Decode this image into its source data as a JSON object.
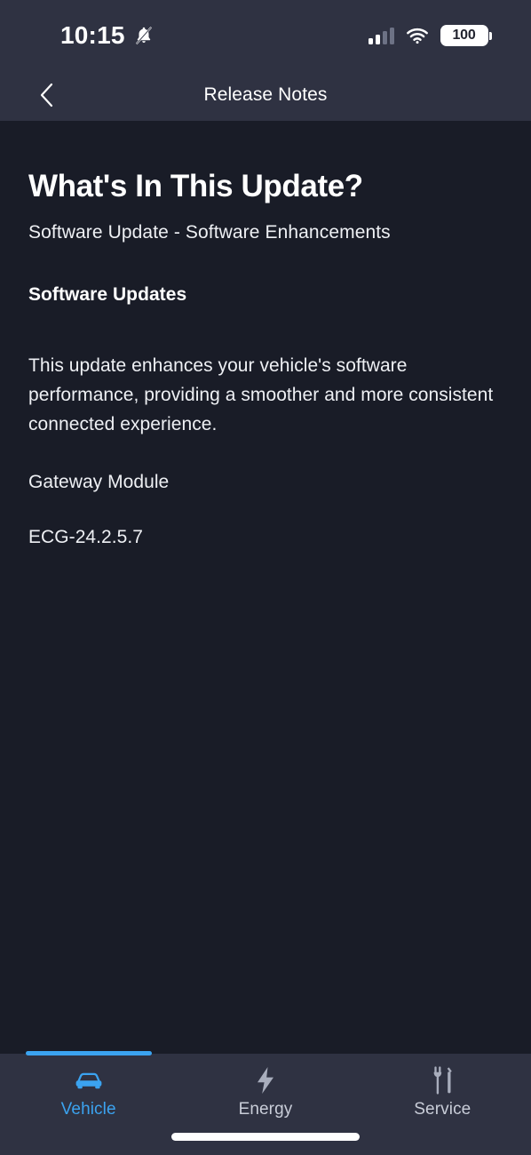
{
  "status_bar": {
    "time": "10:15",
    "notifications_icon": "bell-mute-icon",
    "signal_icon": "cellular-signal-icon",
    "signal_bars_filled": 2,
    "signal_bars_total": 4,
    "wifi_icon": "wifi-icon",
    "battery_level": "100",
    "battery_icon": "battery-full-icon"
  },
  "nav": {
    "back_icon": "chevron-left-icon",
    "title": "Release Notes"
  },
  "content": {
    "page_title": "What's In This Update?",
    "subtitle": "Software Update - Software Enhancements",
    "section_heading": "Software Updates",
    "body_paragraph": "This update enhances your vehicle's software performance, providing a smoother and more consistent connected experience.",
    "module_name": "Gateway Module",
    "version": "ECG-24.2.5.7"
  },
  "tab_bar": {
    "active_index": 0,
    "items": [
      {
        "label": "Vehicle",
        "icon": "car-icon"
      },
      {
        "label": "Energy",
        "icon": "lightning-bolt-icon"
      },
      {
        "label": "Service",
        "icon": "wrench-screwdriver-icon"
      }
    ]
  },
  "colors": {
    "header_bg": "#2f3242",
    "content_bg": "#191c27",
    "accent": "#3ba3f0",
    "text_primary": "#ffffff",
    "text_secondary": "#c9cdd8",
    "icon_inactive": "#a9aebd"
  }
}
